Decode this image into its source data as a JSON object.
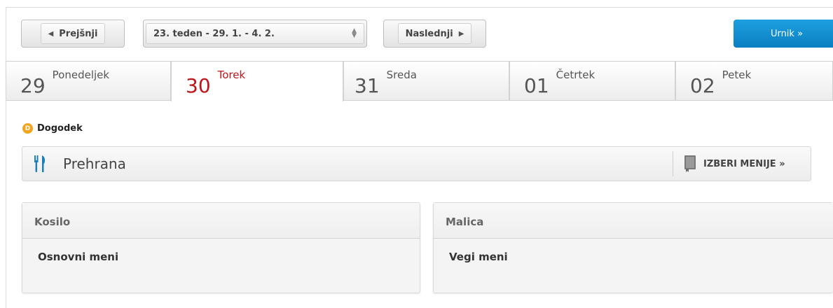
{
  "toolbar": {
    "prev_label": "Prejšnji",
    "week_label": "23. teden - 29. 1. - 4. 2.",
    "next_label": "Naslednji",
    "urnik_label": "Urnik »"
  },
  "days": [
    {
      "num": "29",
      "name": "Ponedeljek",
      "active": false
    },
    {
      "num": "30",
      "name": "Torek",
      "active": true
    },
    {
      "num": "31",
      "name": "Sreda",
      "active": false
    },
    {
      "num": "01",
      "name": "Četrtek",
      "active": false
    },
    {
      "num": "02",
      "name": "Petek",
      "active": false
    }
  ],
  "event": {
    "badge": "D",
    "label": "Dogodek"
  },
  "meal_bar": {
    "title": "Prehrana",
    "action_label": "IZBERI MENIJE »"
  },
  "meals": [
    {
      "type": "Kosilo",
      "menu": "Osnovni meni"
    },
    {
      "type": "Malica",
      "menu": "Vegi meni"
    }
  ],
  "colors": {
    "accent_blue": "#1a8fd3",
    "active_day": "#c0161b",
    "event_dot": "#f2a51f"
  }
}
